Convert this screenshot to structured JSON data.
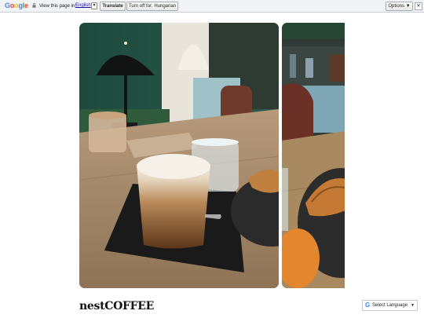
{
  "translate_bar": {
    "logo_letters": [
      "G",
      "o",
      "o",
      "g",
      "l",
      "e"
    ],
    "logo_colors": [
      "#4285f4",
      "#ea4335",
      "#fbbc05",
      "#4285f4",
      "#34a853",
      "#ea4335"
    ],
    "prompt": "View this page in:",
    "language": "English",
    "dropdown_glyph": "▼",
    "translate_label": "Translate",
    "turn_off_label": "Turn off for: Hungarian",
    "options_label": "Options ▼",
    "close_glyph": "✕"
  },
  "gallery": {
    "images": [
      {
        "name": "coffee-cafe-photo",
        "icon": "photo-image"
      },
      {
        "name": "croissant-counter-photo",
        "icon": "photo-image"
      }
    ]
  },
  "brand": {
    "title": "nestCOFFEE"
  },
  "language_widget": {
    "g_glyph": "G",
    "label": "Select Language",
    "arrow": "▼"
  },
  "colors": {
    "wall_green": "#1f4a3c",
    "table_wood": "#a98b6a",
    "page_bg": "#ffffff"
  }
}
